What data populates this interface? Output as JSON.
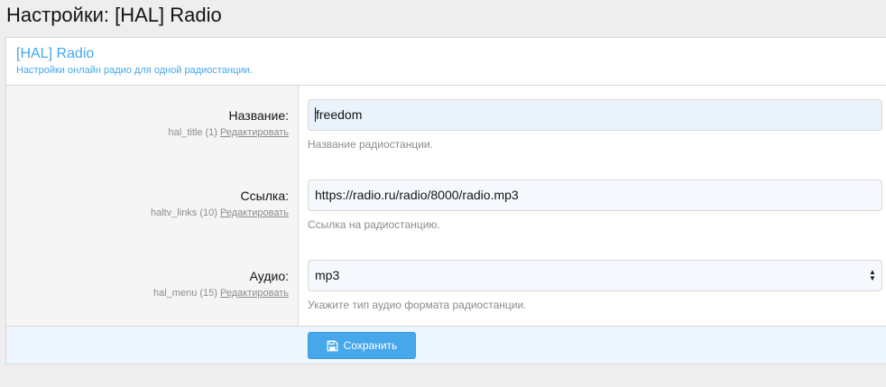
{
  "page": {
    "title": "Настройки: [HAL] Radio"
  },
  "block": {
    "title": "[HAL] Radio",
    "description": "Настройки онлайн радио для одной радиостанции."
  },
  "rows": [
    {
      "label": "Название:",
      "hint_key": "hal_title (1)",
      "edit_label": "Редактировать",
      "value": "freedom",
      "explain": "Название радиостанции."
    },
    {
      "label": "Ссылка:",
      "hint_key": "haltv_links (10)",
      "edit_label": "Редактировать",
      "value": "https://radio.ru/radio/8000/radio.mp3",
      "explain": "Ссылка на радиостанцию."
    },
    {
      "label": "Аудио:",
      "hint_key": "hal_menu (15)",
      "edit_label": "Редактировать",
      "value": "mp3",
      "explain": "Укажите тип аудио формата радиостанции."
    }
  ],
  "footer": {
    "save_label": "Сохранить"
  },
  "icons": {
    "save": "floppy-disk-icon",
    "select": "select-arrows-icon"
  },
  "colors": {
    "accent": "#47a7eb",
    "footer_bg": "#edf6fd"
  }
}
